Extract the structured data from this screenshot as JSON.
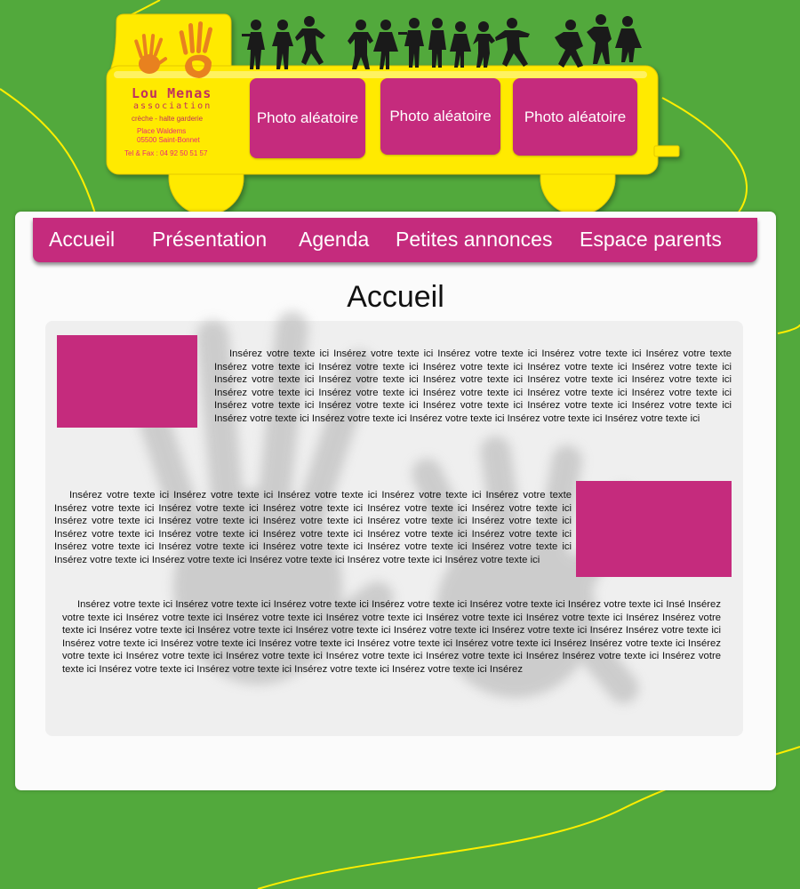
{
  "logo": {
    "name": "Lou Menas",
    "subtitle": "association",
    "tagline": "crèche - halte garderie",
    "address_line1": "Place Waldems",
    "address_line2": "05500 Saint-Bonnet",
    "phone": "Tel & Fax : 04 92 50 51 57"
  },
  "photos": [
    "Photo aléatoire",
    "Photo aléatoire",
    "Photo aléatoire"
  ],
  "nav": {
    "items": [
      "Accueil",
      "Présentation",
      "Agenda",
      "Petites annonces",
      "Espace parents"
    ]
  },
  "page": {
    "title": "Accueil",
    "paragraph1": "Insérez votre texte ici Insérez votre texte ici Insérez votre texte ici Insérez votre texte ici Insérez votre texte Insérez votre texte ici Insérez votre texte ici Insérez votre texte ici Insérez votre texte ici Insérez votre texte ici Insérez votre texte ici Insérez votre texte ici Insérez votre texte ici Insérez votre texte ici Insérez votre texte ici Insérez votre texte ici Insérez votre texte ici Insérez votre texte ici Insérez votre texte ici Insérez votre texte ici Insérez votre texte ici Insérez votre texte ici Insérez votre texte ici Insérez votre texte ici Insérez votre texte ici Insérez votre texte ici Insérez votre texte ici Insérez votre texte ici Insérez votre texte ici Insérez votre texte ici",
    "paragraph2": "Insérez votre texte ici Insérez votre texte ici Insérez votre texte ici Insérez votre texte ici Insérez votre texte Insérez votre texte ici Insérez votre texte ici Insérez votre texte ici Insérez votre texte ici Insérez votre texte ici Insérez votre texte ici Insérez votre texte ici Insérez votre texte ici Insérez votre texte ici Insérez votre texte ici Insérez votre texte ici Insérez votre texte ici Insérez votre texte ici Insérez votre texte ici Insérez votre texte ici Insérez votre texte ici Insérez votre texte ici Insérez votre texte ici Insérez votre texte ici Insérez votre texte ici Insérez votre texte ici Insérez votre texte ici Insérez votre texte ici Insérez votre texte ici Insérez votre texte ici",
    "paragraph3": "Insérez votre texte ici Insérez votre texte ici Insérez votre texte ici Insérez votre texte ici Insérez votre texte ici  Insérez votre texte ici Insé Insérez votre texte ici Insérez votre texte ici Insérez votre texte ici Insérez votre texte ici Insérez votre texte ici Insérez votre texte ici Insérez Insérez votre texte ici Insérez votre texte ici Insérez votre texte ici Insérez votre texte ici Insérez votre texte ici Insérez votre texte ici Insérez Insérez votre texte ici Insérez votre texte ici Insérez votre texte ici Insérez votre texte ici Insérez votre texte ici Insérez votre texte ici Insérez Insérez votre texte ici Insérez votre texte ici Insérez votre texte ici Insérez votre texte ici Insérez votre texte ici Insérez votre texte ici Insérez Insérez votre texte ici Insérez votre texte ici Insérez votre texte ici Insérez votre texte ici Insérez votre texte ici Insérez votre texte ici Insérez"
  },
  "colors": {
    "background": "#52a93c",
    "bus_yellow": "#ffea00",
    "accent_pink": "#c52b7d",
    "panel": "#fbfbfb"
  },
  "icons": [
    "kids-silhouettes-icon",
    "handprints-icon",
    "handprint-watermark-icon"
  ]
}
